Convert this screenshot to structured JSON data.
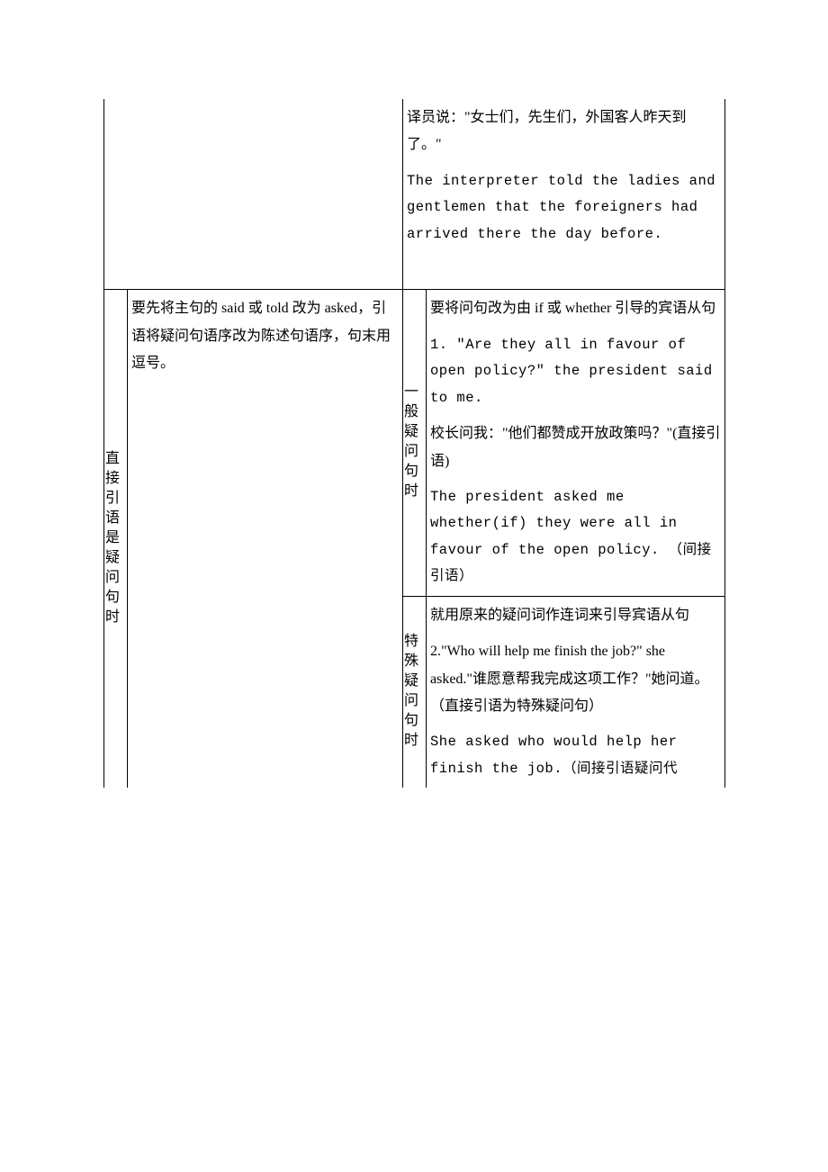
{
  "row1": {
    "cell4": {
      "p1": "译员说：\"女士们，先生们，外国客人昨天到了。\"",
      "p2": "The interpreter told the ladies and gentlemen that the foreigners had arrived there the day before."
    }
  },
  "row2": {
    "vert1": "直接引语是疑问句时",
    "cell2": "要先将主句的 said 或 told 改为 asked，引语将疑问句语序改为陈述句语序，句末用逗号。",
    "sub1": {
      "vert": "一般疑问句时",
      "right": {
        "p1": "要将问句改为由 if 或 whether 引导的宾语从句",
        "p2": "1. \"Are they all in favour of open policy?\" the president said to me.",
        "p3": "校长问我：\"他们都赞成开放政策吗？\"(直接引语)",
        "p4": "The president asked me whether(if) they were all in favour of the open policy. （间接引语）"
      }
    },
    "sub2": {
      "vert": "特殊疑问句时",
      "right": {
        "p1": "就用原来的疑问词作连词来引导宾语从句",
        "p2": "2.\"Who will help me finish the job?\" she asked.\"谁愿意帮我完成这项工作？\"她问道。（直接引语为特殊疑问句）",
        "p3": "She asked who would help her finish the job.（间接引语疑问代"
      }
    }
  }
}
